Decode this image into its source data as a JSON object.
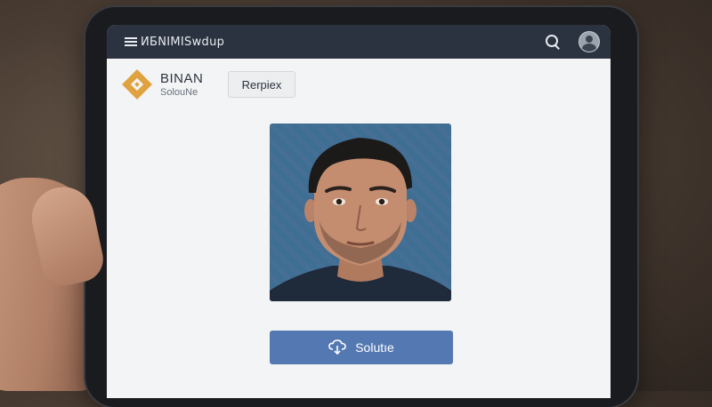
{
  "topbar": {
    "title": "ИБNIMISwdup",
    "icons": [
      "menu-icon",
      "search-icon",
      "avatar-icon"
    ]
  },
  "brand": {
    "name": "BINAN",
    "subtitle": "SolouNe",
    "logo_color": "#e0a23e"
  },
  "toolbar": {
    "secondary_button_label": "Rerpiex"
  },
  "profile": {
    "photo_alt": "Profile photo"
  },
  "action": {
    "primary_button_label": "Solutıe",
    "primary_button_icon": "cloud-icon",
    "primary_color": "#5479b2"
  },
  "colors": {
    "topbar_bg": "#2b3340",
    "screen_bg": "#f3f4f5"
  }
}
